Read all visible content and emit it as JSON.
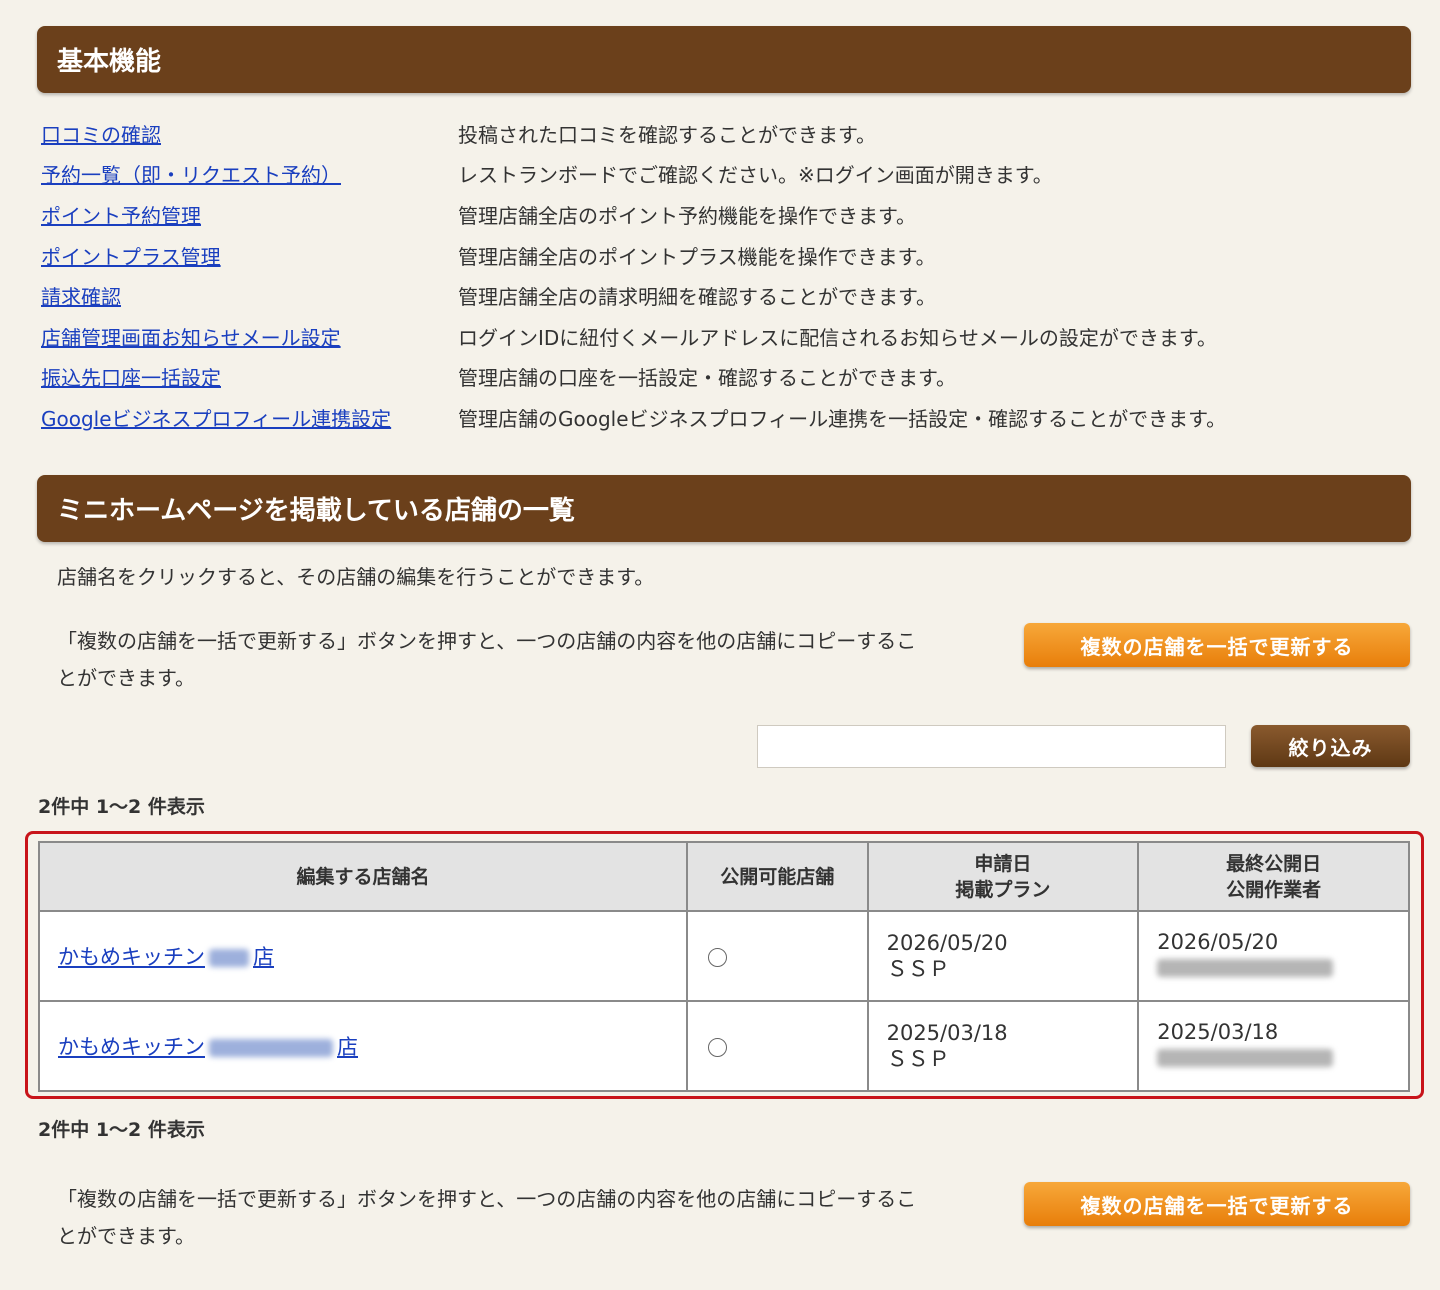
{
  "basic": {
    "title": "基本機能",
    "items": [
      {
        "link": "口コミの確認",
        "desc": "投稿された口コミを確認することができます。"
      },
      {
        "link": "予約一覧（即・リクエスト予約）",
        "desc": "レストランボードでご確認ください。※ログイン画面が開きます。"
      },
      {
        "link": "ポイント予約管理",
        "desc": "管理店舗全店のポイント予約機能を操作できます。"
      },
      {
        "link": "ポイントプラス管理",
        "desc": "管理店舗全店のポイントプラス機能を操作できます。"
      },
      {
        "link": "請求確認",
        "desc": "管理店舗全店の請求明細を確認することができます。"
      },
      {
        "link": "店舗管理画面お知らせメール設定",
        "desc": "ログインIDに紐付くメールアドレスに配信されるお知らせメールの設定ができます。"
      },
      {
        "link": "振込先口座一括設定",
        "desc": "管理店舗の口座を一括設定・確認することができます。"
      },
      {
        "link": "Googleビジネスプロフィール連携設定",
        "desc": "管理店舗のGoogleビジネスプロフィール連携を一括設定・確認することができます。"
      }
    ]
  },
  "mini": {
    "title": "ミニホームページを掲載している店舗の一覧",
    "intro": "店舗名をクリックすると、その店舗の編集を行うことができます。",
    "bulk_line1": "「複数の店舗を一括で更新する」ボタンを押すと、一つの店舗の内容を他の店舗にコピーするこ",
    "bulk_line2": "とができます。",
    "bulk_button": "複数の店舗を一括で更新する",
    "search_button": "絞り込み",
    "count_text": "2件中 1〜2 件表示"
  },
  "table": {
    "headers": {
      "store": "編集する店舗名",
      "publishable": "公開可能店舗",
      "applied_line1": "申請日",
      "applied_line2": "掲載プラン",
      "last_line1": "最終公開日",
      "last_line2": "公開作業者"
    },
    "rows": [
      {
        "store_prefix": "かもめキッチン",
        "store_suffix": "店",
        "applied_date": "2026/05/20",
        "plan": "ＳＳＰ",
        "last_date": "2026/05/20"
      },
      {
        "store_prefix": "かもめキッチン",
        "store_suffix": "店",
        "applied_date": "2025/03/18",
        "plan": "ＳＳＰ",
        "last_date": "2025/03/18"
      }
    ]
  },
  "colors": {
    "header_brown": "#6b401b",
    "accent_orange": "#ee8a1c",
    "link_blue": "#1a3fbf",
    "highlight_red": "#c8141a"
  }
}
